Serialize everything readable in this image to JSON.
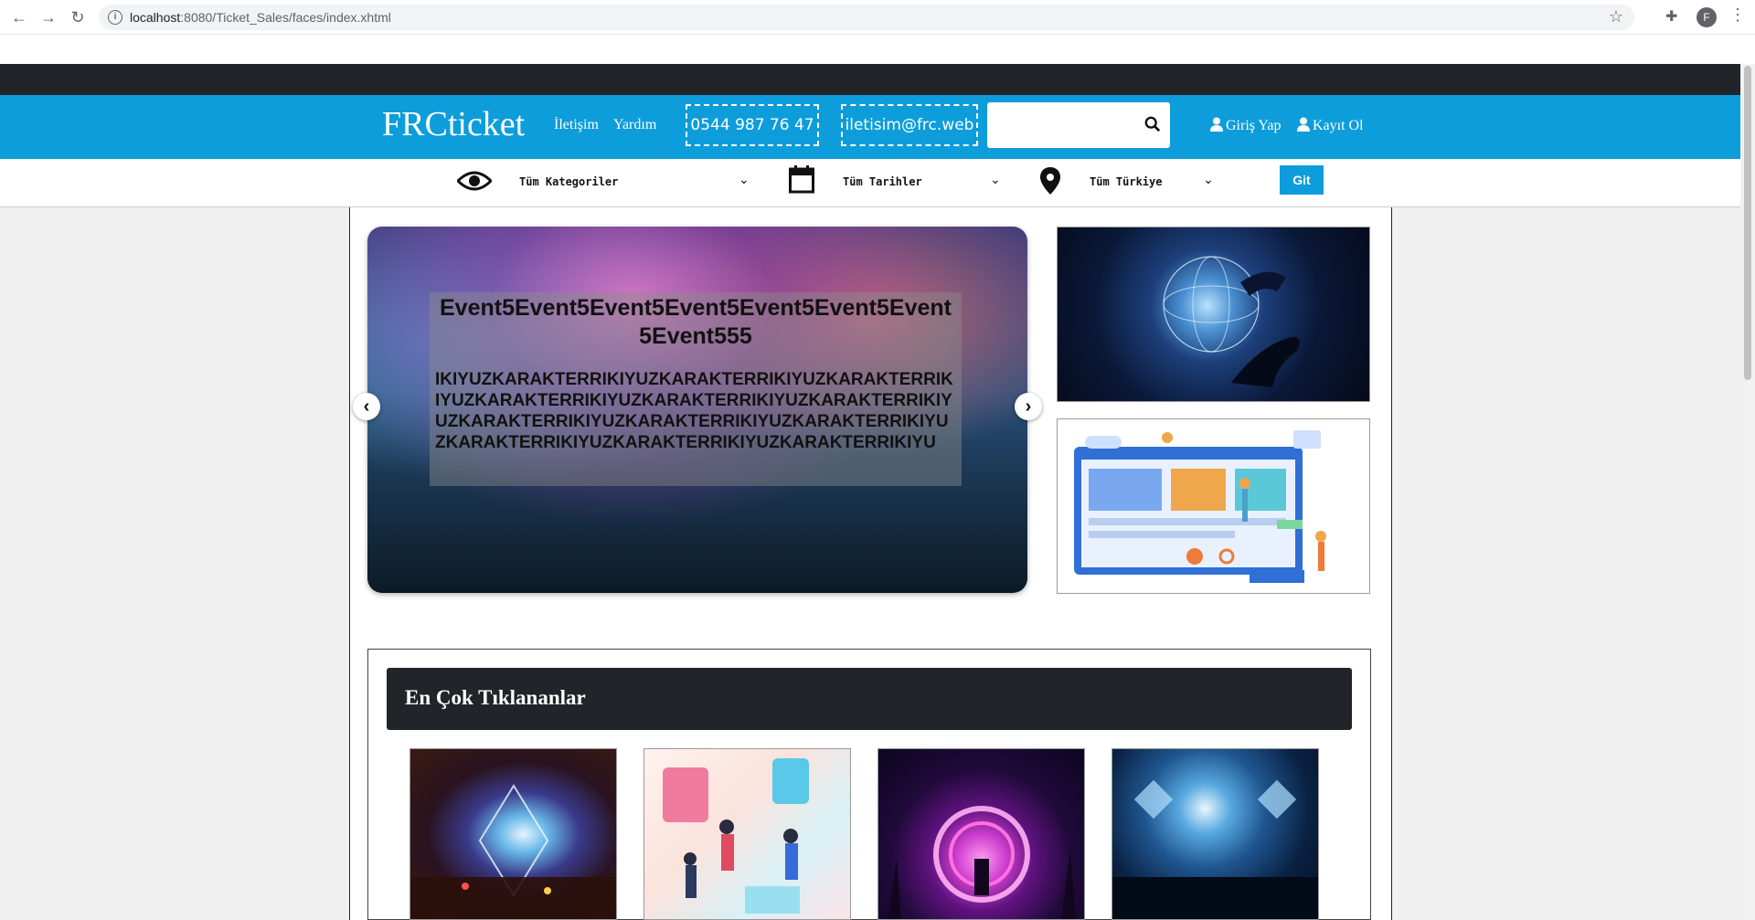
{
  "browser": {
    "url_host": "localhost",
    "url_rest": ":8080/Ticket_Sales/faces/index.xhtml",
    "profile_initial": "F"
  },
  "header": {
    "logo": "FRCticket",
    "links": [
      "İletişim",
      "Yardım"
    ],
    "phone": "0544 987 76 47",
    "email": "iletisim@frc.web",
    "search_placeholder": "",
    "login": "Giriş Yap",
    "register": "Kayıt Ol",
    "color": "#0d9ddb"
  },
  "filters": {
    "category": "Tüm Kategoriler",
    "date": "Tüm Tarihler",
    "location": "Tüm Türkiye",
    "go": "Git"
  },
  "carousel": {
    "title": "Event5Event5Event5Event5Event5Event5Event5Event555",
    "text": "IKIYUZKARAKTERRIKIYUZKARAKTERRIKIYUZKARAKTERRIKIYUZKARAKTERRIKIYUZKARAKTERRIKIYUZKARAKTERRIKIYUZKARAKTERRIKIYUZKARAKTERRIKIYUZKARAKTERRIKIYUZKARAKTERRIKIYUZKARAKTERRIKIYUZKARAKTERRIKIYU",
    "prev": "‹",
    "next": "›"
  },
  "most_clicked": {
    "heading": "En Çok Tıklananlar"
  }
}
